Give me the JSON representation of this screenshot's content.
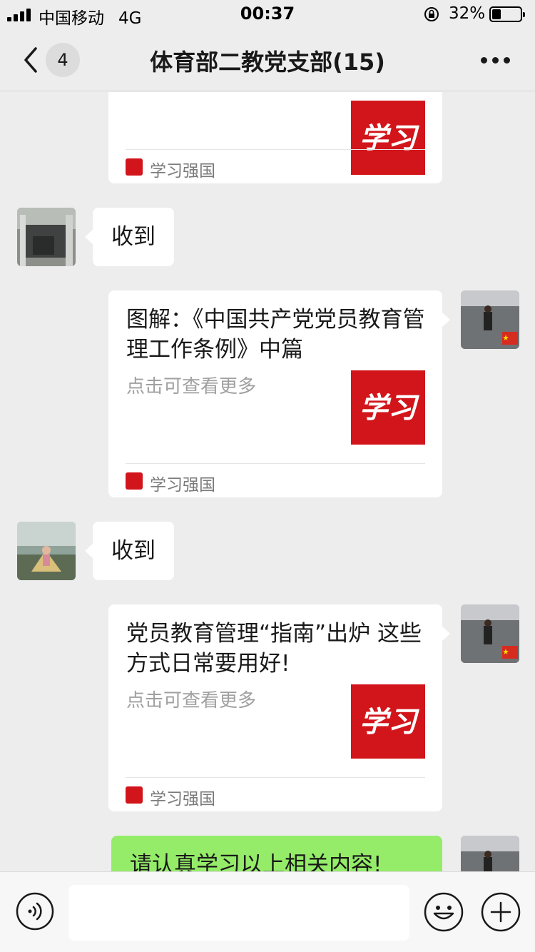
{
  "status_bar": {
    "carrier": "中国移动",
    "network": "4G",
    "time": "00:37",
    "battery_percent": "32%",
    "battery_level": 0.32
  },
  "nav": {
    "unread_count": "4",
    "title": "体育部二教党支部(15)"
  },
  "messages": {
    "card0": {
      "source": "学习强国",
      "thumb_text": "学习"
    },
    "reply1": {
      "text": "收到"
    },
    "card1": {
      "title": "图解：《中国共产党党员教育管理工作条例》中篇",
      "desc": "点击可查看更多",
      "thumb_text": "学习",
      "source": "学习强国"
    },
    "reply2": {
      "text": "收到"
    },
    "card2": {
      "title": "党员教育管理“指南”出炉 这些方式日常要用好!",
      "desc": "点击可查看更多",
      "thumb_text": "学习",
      "source": "学习强国"
    },
    "own_message": {
      "text": "请认真学习以上相关内容!"
    }
  },
  "input": {
    "placeholder": ""
  },
  "colors": {
    "background": "#ededed",
    "bubble_self": "#95ec69",
    "brand_red": "#d2151b"
  }
}
